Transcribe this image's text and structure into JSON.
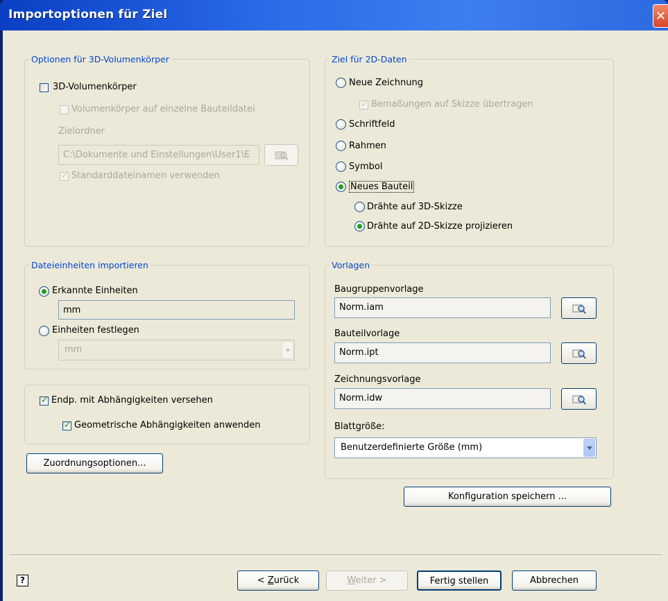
{
  "window": {
    "title": "Importoptionen für Ziel",
    "close_glyph": "✕"
  },
  "solids": {
    "legend": "Optionen für 3D-Volumenkörper",
    "solid_checkbox_label": "3D-Volumenkörper",
    "solid_checked": false,
    "single_file_label": "Volumenkörper auf einzelne Bauteildatei",
    "target_folder_label": "Zielordner",
    "target_folder_value": "C:\\Dokumente und Einstellungen\\User1\\E",
    "default_names_label": "Standarddateinamen verwenden"
  },
  "target2d": {
    "legend": "Ziel für 2D-Daten",
    "new_drawing": "Neue Zeichnung",
    "dimensions_label": "Bemaßungen auf Skizze übertragen",
    "title_block": "Schriftfeld",
    "border": "Rahmen",
    "symbol": "Symbol",
    "new_part": "Neues Bauteil",
    "wires_3d": "Drähte auf 3D-Skizze",
    "wires_2d": "Drähte auf 2D-Skizze projizieren",
    "selected": "Neues Bauteil",
    "selected_sub": "Drähte auf 2D-Skizze projizieren"
  },
  "units": {
    "legend": "Dateieinheiten importieren",
    "detected_label": "Erkannte Einheiten",
    "detected_value": "mm",
    "specify_label": "Einheiten festlegen",
    "specify_value": "mm",
    "selected": "Erkannte Einheiten"
  },
  "constraints": {
    "endpoints_label": "Endp. mit Abhängigkeiten versehen",
    "endpoints_checked": true,
    "geometric_label": "Geometrische Abhängigkeiten anwenden",
    "geometric_checked": true
  },
  "mapping_button": "Zuordnungsoptionen...",
  "templates": {
    "legend": "Vorlagen",
    "assembly_label": "Baugruppenvorlage",
    "assembly_value": "Norm.iam",
    "part_label": "Bauteilvorlage",
    "part_value": "Norm.ipt",
    "drawing_label": "Zeichnungsvorlage",
    "drawing_value": "Norm.idw",
    "sheet_size_label": "Blattgröße:",
    "sheet_size_value": "Benutzerdefinierte Größe (mm)"
  },
  "save_config_button": "Konfiguration speichern ...",
  "footer": {
    "help_glyph": "?",
    "back_prefix": "< ",
    "back_key": "Z",
    "back_rest": "urück",
    "next_key": "W",
    "next_rest": "eiter >",
    "finish": "Fertig stellen",
    "cancel": "Abbrechen"
  },
  "colors": {
    "legend": "#0046d5",
    "check": "#21a121",
    "titlebar": "#2a6be8",
    "dialog_bg": "#ece9d8"
  }
}
